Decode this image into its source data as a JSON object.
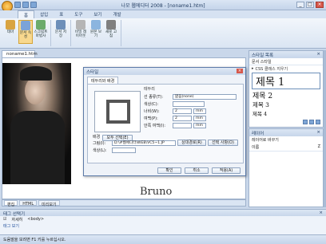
{
  "app": {
    "title": "나모 웹에디터 2008 - [noname1.htm]"
  },
  "ribbon_tabs": [
    "홈",
    "삽입",
    "표",
    "도구",
    "보기",
    "개발"
  ],
  "ribbon_buttons": [
    {
      "label": "테마",
      "color": "#d9a441"
    },
    {
      "label": "문서 속성",
      "color": "#7ba3d8"
    },
    {
      "label": "스크립트 마법사",
      "color": "#6cab6c"
    },
    {
      "label": "문서 저장",
      "color": "#6d8fb9"
    },
    {
      "label": "비밀 레이아웃",
      "color": "#b5b5b5"
    },
    {
      "label": "원본 보기",
      "color": "#8bb5df"
    },
    {
      "label": "새로 고침",
      "color": "#7f7f7f"
    }
  ],
  "document_tab": "noname1.htm",
  "editor": {
    "caption": "Bruno"
  },
  "view_tabs": [
    "편집",
    "HTML",
    "미리보기"
  ],
  "style_panel": {
    "title": "스타일 목록",
    "subtitle": "문서 스타일",
    "option": "CSS 클래스 지우기",
    "headings": [
      "제목 1",
      "제목 2",
      "제목 3",
      "제목 4"
    ]
  },
  "layer_panel": {
    "title": "레이어",
    "option": "레이어로 바꾸기",
    "col_name": "이름",
    "col_z": "Z"
  },
  "tag_panel": {
    "title": "태그 선택기",
    "checkbox_label": "자세히",
    "path": "<body>",
    "link": "태그 보기"
  },
  "status": "도움말을 보려면 F1 키를 누르십시오.",
  "dialog": {
    "title": "스타일",
    "tabs": [
      "테두리와 배경"
    ],
    "section_border": "테두리",
    "section_bg": "배경",
    "fields": [
      {
        "label": "선 종류(T):",
        "value": "없음(none)"
      },
      {
        "label": "색상(C):",
        "value": ""
      },
      {
        "label": "너비(W):",
        "value": "2"
      },
      {
        "label": "여백(P):",
        "value": "2"
      },
      {
        "label": "안쪽 여백(I):",
        "value": ""
      }
    ],
    "unit_px": "mm",
    "preview_btn": "모두 선택(E)",
    "bg_image_label": "그림(I):",
    "bg_image_value": "D:\\#웹에디터\\WEB\\VC5~1.JP",
    "bg_abs_btn": "상대경로(R)",
    "bg_select_btn": "선택 사항(O)",
    "bg_color_label": "색상(L):",
    "ok": "확인",
    "cancel": "취소",
    "apply": "적용(A)"
  }
}
